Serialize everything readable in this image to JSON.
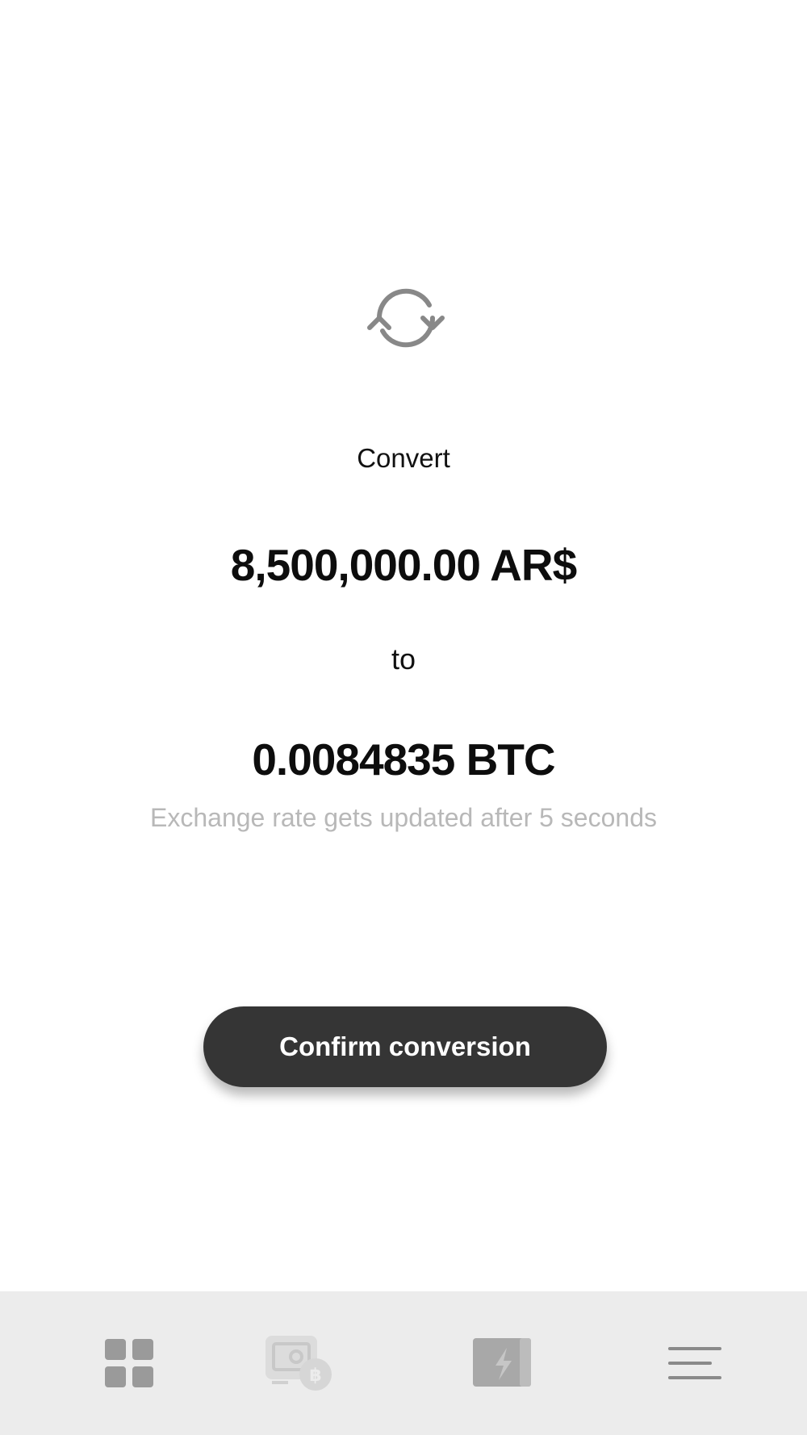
{
  "conversion": {
    "title": "Convert",
    "from_amount": "8,500,000.00 AR$",
    "connector": "to",
    "to_amount": "0.0084835 BTC",
    "rate_note": "Exchange rate gets updated after 5 seconds"
  },
  "actions": {
    "confirm_label": "Confirm conversion"
  },
  "icons": {
    "convert": "refresh-arrows-icon",
    "nav": [
      "dashboard-grid-icon",
      "cash-bitcoin-icon",
      "lightning-card-icon",
      "menu-icon"
    ]
  },
  "colors": {
    "button_bg": "#353535",
    "nav_bg": "#ececec",
    "icon_gray": "#888888",
    "note_gray": "#b8b8b8"
  }
}
